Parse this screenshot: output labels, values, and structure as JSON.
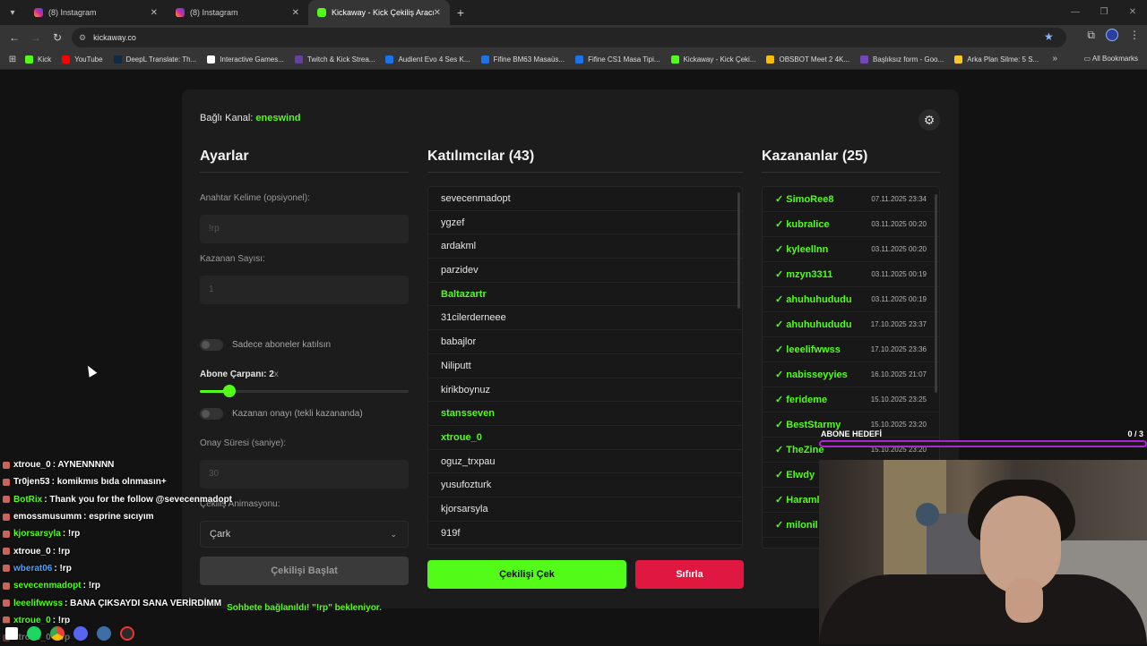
{
  "browser": {
    "tabs": [
      {
        "label": "(8) Instagram",
        "icon": "instagram-icon"
      },
      {
        "label": "(8) Instagram",
        "icon": "instagram-icon"
      },
      {
        "label": "Kickaway - Kick Çekiliş Aracı",
        "icon": "kick-icon"
      }
    ],
    "url": "kickaway.co",
    "bookmarks": [
      {
        "label": "Kick",
        "color": "#53fc18"
      },
      {
        "label": "YouTube",
        "color": "#ff0000"
      },
      {
        "label": "DeepL Translate: Th...",
        "color": "#0f2b46"
      },
      {
        "label": "Interactive Games...",
        "color": "#ffffff"
      },
      {
        "label": "Twitch & Kick Strea...",
        "color": "#6441a5"
      },
      {
        "label": "Audient Evo 4 Ses K...",
        "color": "#1a73e8"
      },
      {
        "label": "Fifine BM63 Masaüs...",
        "color": "#1a73e8"
      },
      {
        "label": "Fifine CS1 Masa Tipi...",
        "color": "#1a73e8"
      },
      {
        "label": "Kickaway - Kick Çeki...",
        "color": "#53fc18"
      },
      {
        "label": "OBSBOT Meet 2 4K...",
        "color": "#fbbc04"
      },
      {
        "label": "Başlıksız form - Goo...",
        "color": "#7248b9"
      },
      {
        "label": "Arka Plan Silme: 5 S...",
        "color": "#f9c623"
      }
    ],
    "all_bookmarks": "All Bookmarks"
  },
  "app": {
    "channel_label": "Bağlı Kanal:",
    "channel_name": "eneswind",
    "settings": {
      "title": "Ayarlar",
      "keyword_label": "Anahtar Kelime (opsiyonel):",
      "keyword_placeholder": "!rp",
      "winner_count_label": "Kazanan Sayısı:",
      "winner_count_value": "1",
      "subscribers_only_label": "Sadece aboneler katılsın",
      "sub_multiplier_label": "Abone Çarpanı: 2",
      "sub_multiplier_unit": "x",
      "sub_multiplier_value": 2,
      "sub_multiplier_fill": 0.14,
      "winner_confirm_label": "Kazanan onayı (tekli kazananda)",
      "confirm_time_label": "Onay Süresi (saniye):",
      "confirm_time_value": "30",
      "animation_label": "Çekiliş Animasyonu:",
      "animation_value": "Çark",
      "start_button": "Çekilişi Başlat",
      "status": "Sohbete bağlanıldı! \"!rp\" bekleniyor."
    },
    "participants": {
      "title": "Katılımcılar (43)",
      "items": [
        {
          "name": "sevecenmadopt",
          "highlight": false
        },
        {
          "name": "ygzef",
          "highlight": false
        },
        {
          "name": "ardakml",
          "highlight": false
        },
        {
          "name": "parzidev",
          "highlight": false
        },
        {
          "name": "Baltazartr",
          "highlight": true
        },
        {
          "name": "31cilerderneee",
          "highlight": false
        },
        {
          "name": "babajlor",
          "highlight": false
        },
        {
          "name": "Niliputt",
          "highlight": false
        },
        {
          "name": "kirikboynuz",
          "highlight": false
        },
        {
          "name": "stansseven",
          "highlight": true
        },
        {
          "name": "xtroue_0",
          "highlight": true
        },
        {
          "name": "oguz_trxpau",
          "highlight": false
        },
        {
          "name": "yusufozturk",
          "highlight": false
        },
        {
          "name": "kjorsarsyla",
          "highlight": false
        },
        {
          "name": "919f",
          "highlight": false
        }
      ],
      "draw_button": "Çekilişi Çek",
      "reset_button": "Sıfırla"
    },
    "winners": {
      "title": "Kazananlar (25)",
      "items": [
        {
          "name": "✓ SimoRee8",
          "date": "07.11.2025 23:34"
        },
        {
          "name": "✓ kubralice",
          "date": "03.11.2025 00:20"
        },
        {
          "name": "✓ kyleellnn",
          "date": "03.11.2025 00:20"
        },
        {
          "name": "✓ mzyn3311",
          "date": "03.11.2025 00:19"
        },
        {
          "name": "✓ ahuhuhududu",
          "date": "03.11.2025 00:19"
        },
        {
          "name": "✓ ahuhuhududu",
          "date": "17.10.2025 23:37"
        },
        {
          "name": "✓ leeelifwwss",
          "date": "17.10.2025 23:36"
        },
        {
          "name": "✓ nabisseyyies",
          "date": "16.10.2025 21:07"
        },
        {
          "name": "✓ ferideme",
          "date": "15.10.2025 23:25"
        },
        {
          "name": "✓ BestStarmy",
          "date": "15.10.2025 23:20"
        },
        {
          "name": "✓ TheZine",
          "date": "15.10.2025 23:20"
        },
        {
          "name": "✓ Elwdy",
          "date": ""
        },
        {
          "name": "✓ Haraml",
          "date": ""
        },
        {
          "name": "✓ milonil",
          "date": ""
        }
      ]
    }
  },
  "chat": [
    {
      "user": "xtroue_0",
      "msg": ": AYNENNNNN",
      "color": "#ffffff"
    },
    {
      "user": "Tr0jen53",
      "msg": ": komikmıs bıda olnmasın+",
      "color": "#ffffff"
    },
    {
      "user": "BotRix",
      "msg": ": Thank you for the follow @sevecenmadopt",
      "color": "#53fc18"
    },
    {
      "user": "emossmusumm",
      "msg": ": esprine sıcıyım",
      "color": "#ffffff"
    },
    {
      "user": "kjorsarsyla",
      "msg": ": !rp",
      "color": "#53fc18"
    },
    {
      "user": "xtroue_0",
      "msg": ": !rp",
      "color": "#ffffff"
    },
    {
      "user": "wberat06",
      "msg": ": !rp",
      "color": "#4aa3ff"
    },
    {
      "user": "sevecenmadopt",
      "msg": ": !rp",
      "color": "#53fc18"
    },
    {
      "user": "leeelifwwss",
      "msg": ": BANA ÇIKSAYDI SANA VERİRDİMM",
      "color": "#53fc18"
    },
    {
      "user": "xtroue_0",
      "msg": ": !rp",
      "color": "#53fc18"
    },
    {
      "user": "xtroue_0",
      "msg": ": !rp",
      "color": "#ffffff"
    }
  ],
  "goal": {
    "label": "ABONE HEDEFİ",
    "count": "0 / 3"
  }
}
